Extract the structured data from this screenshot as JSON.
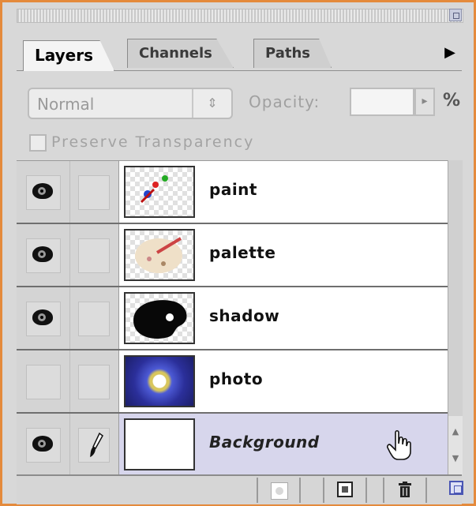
{
  "tabs": [
    {
      "label": "Layers",
      "active": true
    },
    {
      "label": "Channels",
      "active": false
    },
    {
      "label": "Paths",
      "active": false
    }
  ],
  "options": {
    "blend_mode": "Normal",
    "opacity_label": "Opacity:",
    "opacity_value": "",
    "percent_sign": "%"
  },
  "preserve_transparency": {
    "label": "Preserve Transparency",
    "checked": false
  },
  "layers": [
    {
      "name": "paint",
      "visible": true,
      "linked": false,
      "selected": false
    },
    {
      "name": "palette",
      "visible": true,
      "linked": false,
      "selected": false
    },
    {
      "name": "shadow",
      "visible": true,
      "linked": false,
      "selected": false
    },
    {
      "name": "photo",
      "visible": false,
      "linked": false,
      "selected": false
    },
    {
      "name": "Background",
      "visible": true,
      "linked": true,
      "selected": true
    }
  ],
  "icons": {
    "visibility": "eye-icon",
    "brush": "paintbrush-icon",
    "cursor": "hand-cursor-icon",
    "new_layer": "new-layer-icon",
    "delete": "trash-icon",
    "mask": "layer-mask-icon",
    "menu": "panel-menu-arrow-icon",
    "resize": "resize-corner-icon"
  },
  "colors": {
    "frame_accent": "#e48a3c",
    "selected_row": "#d7d6ec",
    "panel_bg": "#d8d8d8"
  }
}
